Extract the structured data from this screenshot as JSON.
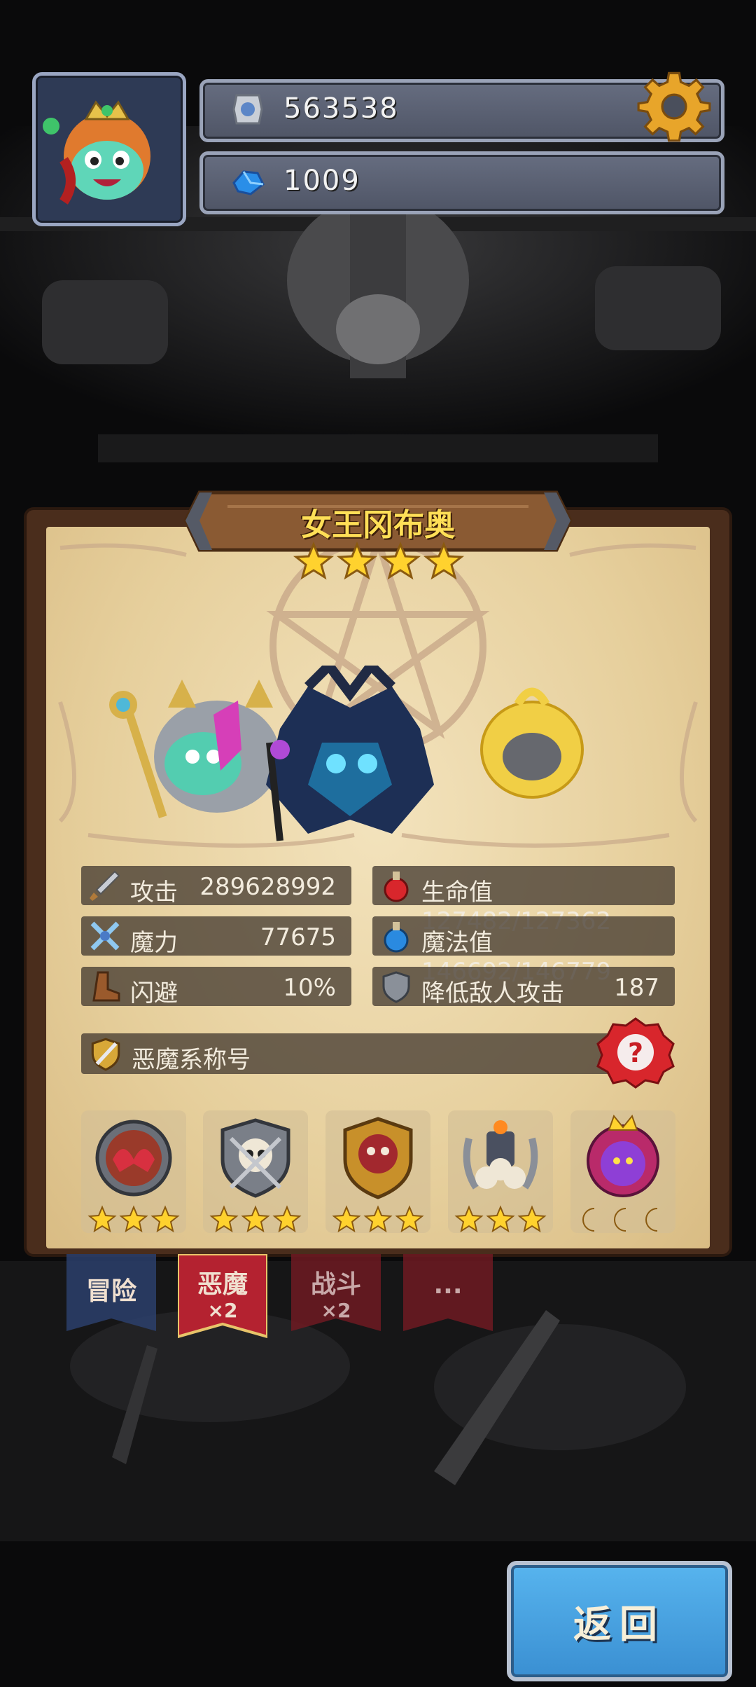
{
  "header": {
    "gold_amount": "563538",
    "gem_amount": "1009"
  },
  "hero": {
    "name": "女王冈布奥",
    "star_count": 4
  },
  "stats": {
    "attack_label": "攻击",
    "attack_value": "289628992",
    "hp_label": "生命值127482/127362",
    "magic_label": "魔力",
    "magic_value": "77675",
    "mp_label": "魔法值146692/146779",
    "dodge_label": "闪避",
    "dodge_value": "10%",
    "reduce_label": "降低敌人攻击",
    "reduce_value": "187"
  },
  "title_row": {
    "label": "恶魔系称号"
  },
  "badges": [
    {
      "icon": "red-wing-shield-icon",
      "stars": 3
    },
    {
      "icon": "skull-shield-icon",
      "stars": 3
    },
    {
      "icon": "demon-face-shield-icon",
      "stars": 3
    },
    {
      "icon": "skull-pile-icon",
      "stars": 3
    },
    {
      "icon": "purple-demon-king-icon",
      "moons": 3
    }
  ],
  "tabs": [
    {
      "label": "冒险",
      "sub": ""
    },
    {
      "label": "恶魔",
      "sub": "×2"
    },
    {
      "label": "战斗",
      "sub": "×2"
    },
    {
      "label": "...",
      "sub": ""
    }
  ],
  "back_button": "返回",
  "colors": {
    "title_gold": "#ffdf57",
    "star_gold": "#ffd22e",
    "back_blue": "#3a8fd2",
    "active_tab_red": "#b42230"
  }
}
